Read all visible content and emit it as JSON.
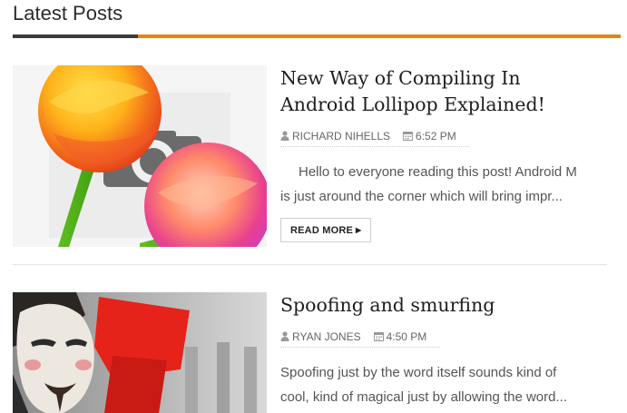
{
  "section": {
    "title": "Latest Posts"
  },
  "posts": [
    {
      "title_line1": "New Way of Compiling In",
      "title_line2": "Android Lollipop Explained!",
      "author": "RICHARD NIHELLS",
      "time": "6:52 PM",
      "excerpt_line1": "Hello to everyone reading this post!  Android M",
      "excerpt_line2": "is just around the corner which will bring impr...",
      "read_more": "READ MORE",
      "thumbnail": "android-lollipop-icon"
    },
    {
      "title": "Spoofing and smurfing",
      "author": "RYAN JONES",
      "time": "4:50 PM",
      "excerpt_line1": "Spoofing just by the word itself sounds kind of",
      "excerpt_line2": "cool, kind of magical just by allowing the word...",
      "thumbnail": "guy-fawkes-mask-protest-photo"
    }
  ],
  "colors": {
    "accent": "#e5870f",
    "dark_rule": "#3a3a3a"
  }
}
